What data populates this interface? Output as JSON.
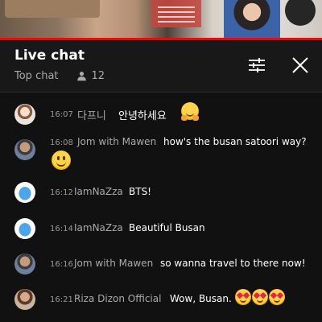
{
  "video": {
    "progress_fraction": 1.0,
    "accent": "#ff0000"
  },
  "header": {
    "title": "Live chat",
    "mode": "Top chat",
    "viewers": "12",
    "filter_icon": "sliders-icon",
    "close_icon": "close-icon"
  },
  "messages": [
    {
      "time": "16:07",
      "author": "다프니",
      "text": "안녕하세요",
      "emoji": [
        "hugging-face"
      ],
      "avatar": "girl-avatar"
    },
    {
      "time": "16:08",
      "author": "Jom with Mawen",
      "text": "how's the busan satoori way?",
      "emoji": [
        "smiling-face"
      ],
      "avatar": "man-avatar"
    },
    {
      "time": "16:12",
      "author": "IamNaZza",
      "text": "BTS!",
      "emoji": [],
      "avatar": "blue-avatar"
    },
    {
      "time": "16:14",
      "author": "IamNaZza",
      "text": "Beautiful Busan",
      "emoji": [],
      "avatar": "blue-avatar"
    },
    {
      "time": "16:16",
      "author": "Jom with Mawen",
      "text": "so wanna travel to there now!",
      "emoji": [],
      "avatar": "man-avatar"
    },
    {
      "time": "16:21",
      "author": "Riza Dizon Official",
      "text": "Wow, Busan.",
      "emoji": [
        "heart-eyes",
        "heart-eyes",
        "heart-eyes"
      ],
      "avatar": "woman-avatar"
    }
  ],
  "colors": {
    "background": "#111111",
    "header": "#181818",
    "author": "#aaaaaa",
    "time": "#999999"
  }
}
